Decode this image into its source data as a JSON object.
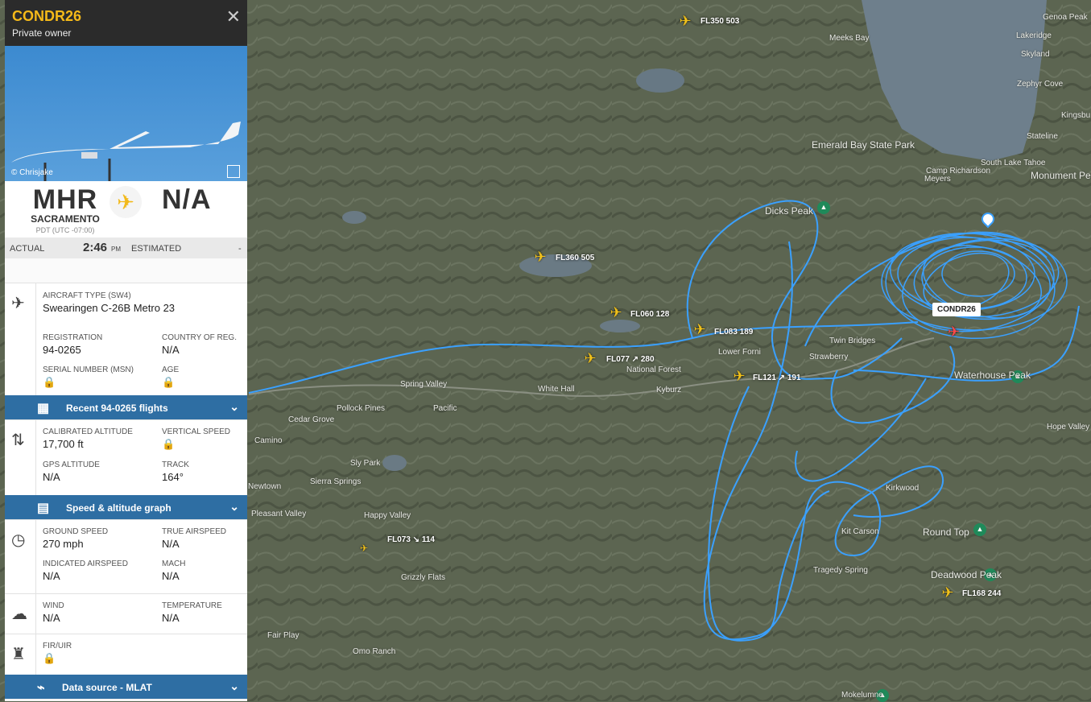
{
  "flight": {
    "callsign": "CONDR26",
    "owner": "Private owner",
    "close_icon": "close-icon",
    "photo_credit": "© Chrisjake"
  },
  "route": {
    "origin_code": "MHR",
    "origin_city": "SACRAMENTO",
    "origin_tz": "PDT (UTC -07:00)",
    "dest_code": "N/A",
    "actual_label": "ACTUAL",
    "actual_time": "2:46",
    "actual_ampm": "PM",
    "estimated_label": "ESTIMATED",
    "estimated_value": "-"
  },
  "aircraft": {
    "type_label": "AIRCRAFT TYPE",
    "type_code": "(SW4)",
    "type_name": "Swearingen C-26B Metro 23",
    "registration_label": "REGISTRATION",
    "registration": "94-0265",
    "country_label": "COUNTRY OF REG.",
    "country": "N/A",
    "serial_label": "SERIAL NUMBER (MSN)",
    "age_label": "AGE"
  },
  "recent_bar": "Recent 94-0265 flights",
  "altitude": {
    "cal_label": "CALIBRATED ALTITUDE",
    "cal_value": "17,700 ft",
    "vs_label": "VERTICAL SPEED",
    "gps_label": "GPS ALTITUDE",
    "gps_value": "N/A",
    "track_label": "TRACK",
    "track_value": "164°"
  },
  "speed_bar": "Speed & altitude graph",
  "speed": {
    "gs_label": "GROUND SPEED",
    "gs_value": "270 mph",
    "tas_label": "TRUE AIRSPEED",
    "tas_value": "N/A",
    "ias_label": "INDICATED AIRSPEED",
    "ias_value": "N/A",
    "mach_label": "MACH",
    "mach_value": "N/A"
  },
  "weather": {
    "wind_label": "WIND",
    "wind_value": "N/A",
    "temp_label": "TEMPERATURE",
    "temp_value": "N/A"
  },
  "fir": {
    "label": "FIR/UIR"
  },
  "datasource_bar": "Data source - MLAT",
  "map": {
    "callsign_tag": "CONDR26",
    "flights": [
      {
        "label": "FL350 503"
      },
      {
        "label": "FL360 505"
      },
      {
        "label": "FL060 128"
      },
      {
        "label": "FL083 189"
      },
      {
        "label": "FL077 ↗ 280"
      },
      {
        "label": "FL121 ↗ 191"
      },
      {
        "label": "FL073 ↘ 114"
      },
      {
        "label": "FL168 244"
      }
    ],
    "places": [
      "Meeks Bay",
      "Emerald Bay State Park",
      "Camp Richardson",
      "South Lake Tahoe",
      "Stateline",
      "Zephyr Cove",
      "Skyland",
      "Lakeridge",
      "Genoa Peak",
      "Kingsbu",
      "Monument Peak",
      "Dicks Peak",
      "Lower Forni",
      "Strawberry",
      "Twin Bridges",
      "Waterhouse Peak",
      "Hope Valley",
      "Kirkwood",
      "Round Top",
      "Kit Carson",
      "Tragedy Spring",
      "Deadwood Peak",
      "White Hall",
      "Kyburz",
      "Pacific",
      "Pollock Pines",
      "Spring Valley",
      "Cedar Grove",
      "Camino",
      "Sly Park",
      "Sierra Springs",
      "Newtown",
      "Pleasant Valley",
      "Happy Valley",
      "Grizzly Flats",
      "Fair Play",
      "Omo Ranch",
      "Mokelumne",
      "Meyers",
      "National Forest"
    ]
  },
  "colors": {
    "accent": "#2e6ea3",
    "track": "#3aa0ff",
    "plane": "#f2c21b",
    "callsign": "#f5b919"
  }
}
